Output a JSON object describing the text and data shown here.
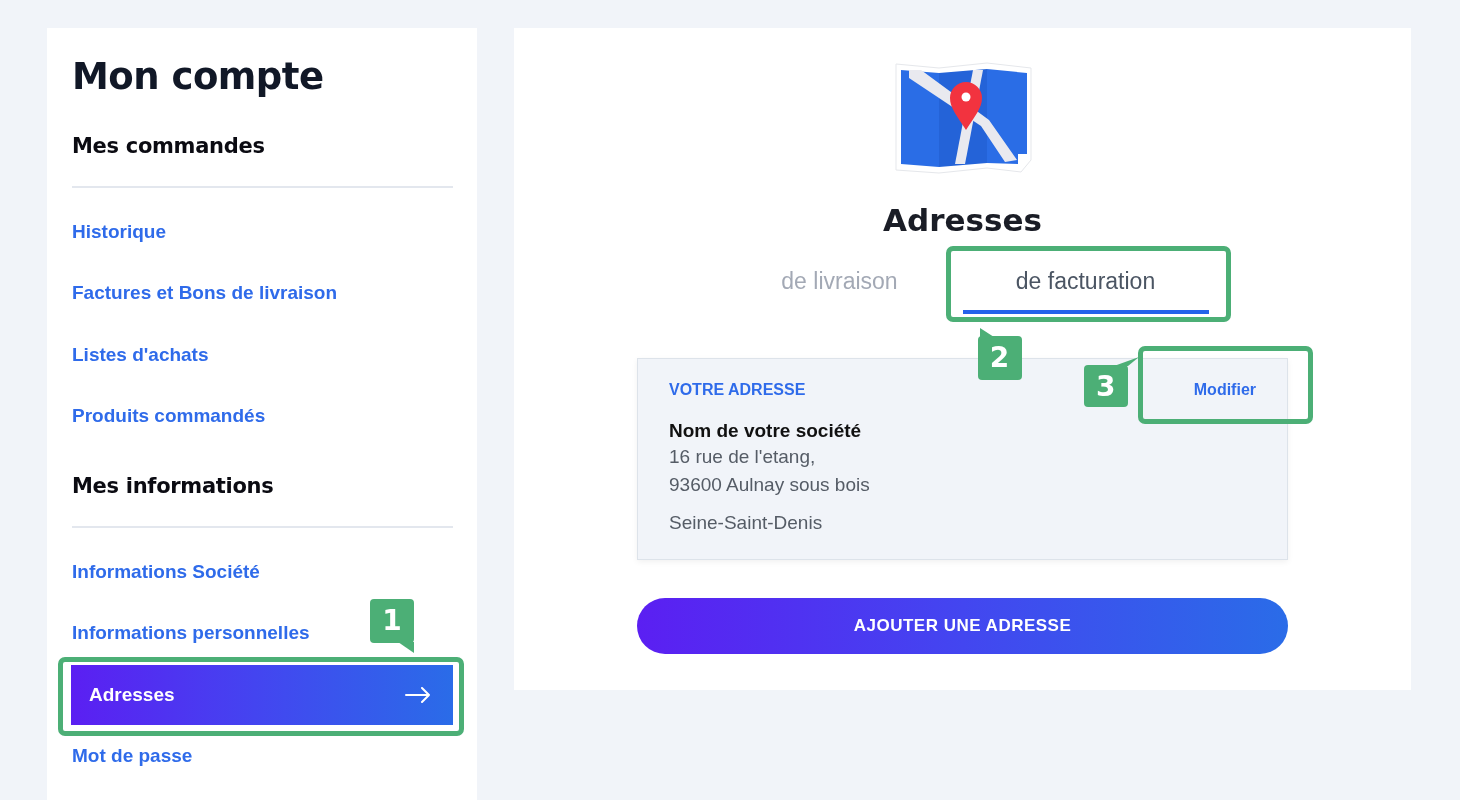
{
  "sidebar": {
    "title": "Mon compte",
    "sections": [
      {
        "heading": "Mes commandes",
        "items": [
          {
            "label": "Historique",
            "selected": false
          },
          {
            "label": "Factures et Bons de livraison",
            "selected": false
          },
          {
            "label": "Listes d'achats",
            "selected": false
          },
          {
            "label": "Produits commandés",
            "selected": false
          }
        ]
      },
      {
        "heading": "Mes informations",
        "items": [
          {
            "label": "Informations Société",
            "selected": false
          },
          {
            "label": "Informations personnelles",
            "selected": false
          },
          {
            "label": "Adresses",
            "selected": true,
            "callout": "1"
          },
          {
            "label": "Mot de passe",
            "selected": false
          }
        ]
      }
    ]
  },
  "main": {
    "title": "Adresses",
    "tabs": [
      {
        "label": "de livraison",
        "selected": false
      },
      {
        "label": "de facturation",
        "selected": true,
        "callout": "2"
      }
    ],
    "address_card": {
      "heading": "VOTRE ADRESSE",
      "action": {
        "label": "Modifier",
        "callout": "3"
      },
      "name": "Nom de votre société",
      "lines": [
        "16 rue de l'etang,",
        "93600 Aulnay sous bois"
      ],
      "region": "Seine-Saint-Denis"
    },
    "add_button": "AJOUTER UNE ADRESSE"
  }
}
